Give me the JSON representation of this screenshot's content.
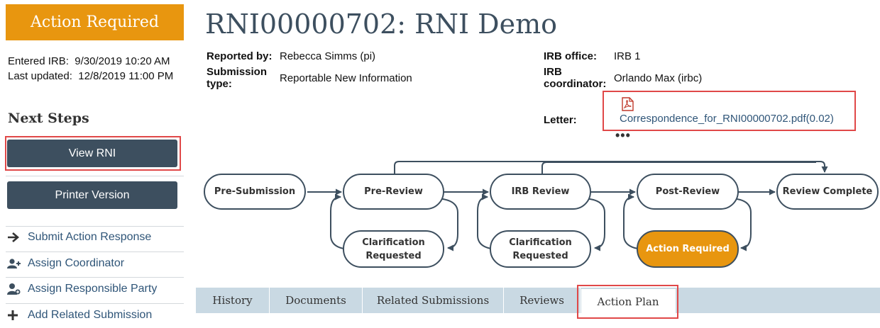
{
  "status": {
    "label": "Action Required"
  },
  "meta": {
    "entered_label": "Entered IRB:",
    "entered_value": "9/30/2019 10:20 AM",
    "updated_label": "Last updated:",
    "updated_value": "12/8/2019 11:00 PM"
  },
  "next_steps": {
    "heading": "Next Steps",
    "view_button": "View RNI",
    "printer_button": "Printer Version",
    "actions": [
      {
        "label": "Submit Action Response",
        "icon": "arrow-right-icon"
      },
      {
        "label": "Assign Coordinator",
        "icon": "user-add-icon"
      },
      {
        "label": "Assign Responsible Party",
        "icon": "user-assign-icon"
      },
      {
        "label": "Add Related Submission",
        "icon": "plus-icon"
      }
    ]
  },
  "header": {
    "title": "RNI00000702: RNI Demo",
    "reported_by_label": "Reported by:",
    "reported_by_value": "Rebecca Simms (pi)",
    "submission_type_label_1": "Submission",
    "submission_type_label_2": "type:",
    "submission_type_value": "Reportable New Information",
    "irb_office_label": "IRB office:",
    "irb_office_value": "IRB 1",
    "irb_coordinator_label_1": "IRB",
    "irb_coordinator_label_2": "coordinator:",
    "irb_coordinator_value": "Orlando Max (irbc)",
    "letter_label": "Letter:",
    "letter_link": "Correspondence_for_RNI00000702.pdf(0.02)",
    "letter_icon": "pdf-icon",
    "more": "•••"
  },
  "workflow": {
    "pre_submission": "Pre-Submission",
    "pre_review": "Pre-Review",
    "irb_review": "IRB Review",
    "post_review": "Post-Review",
    "review_complete": "Review Complete",
    "clarification_1a": "Clarification",
    "clarification_1b": "Requested",
    "clarification_2a": "Clarification",
    "clarification_2b": "Requested",
    "action_required": "Action Required"
  },
  "tabs": [
    "History",
    "Documents",
    "Related Submissions",
    "Reviews",
    "Action Plan"
  ],
  "active_tab": "Action Plan",
  "colors": {
    "accent": "#e8960f",
    "dark": "#3d4f5f",
    "highlight": "#e04848",
    "link": "#2f5578",
    "tab_bar": "#c9d9e3"
  }
}
